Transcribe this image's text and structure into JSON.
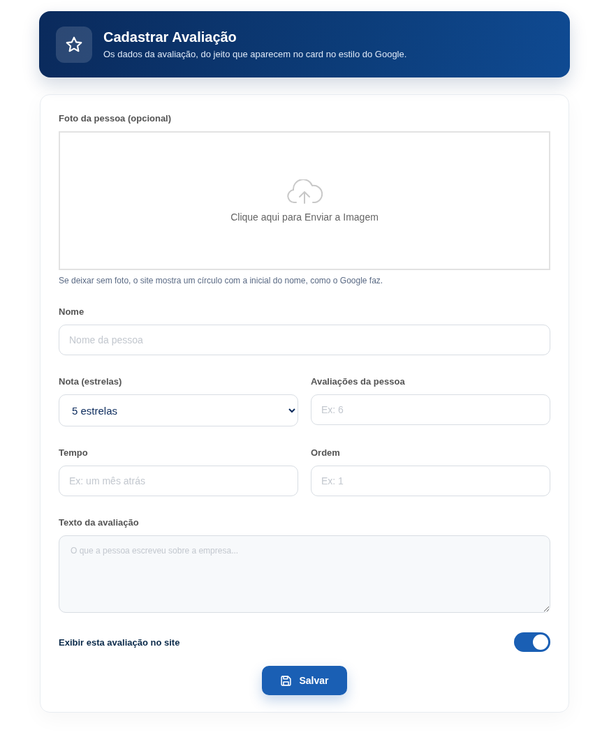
{
  "header": {
    "title": "Cadastrar Avaliação",
    "subtitle": "Os dados da avaliação, do jeito que aparecem no card no estilo do Google."
  },
  "photo": {
    "label": "Foto da pessoa (opcional)",
    "upload_text": "Clique aqui para Enviar a Imagem",
    "hint": "Se deixar sem foto, o site mostra um círculo com a inicial do nome, como o Google faz."
  },
  "rows": [
    [
      {
        "kind": "text",
        "label": "Nome",
        "placeholder": "Nome da pessoa"
      }
    ],
    [
      {
        "kind": "select",
        "label": "Nota (estrelas)",
        "value": "5 estrelas"
      },
      {
        "kind": "text",
        "label": "Avaliações da pessoa",
        "placeholder": "Ex: 6"
      }
    ],
    [
      {
        "kind": "text",
        "label": "Tempo",
        "placeholder": "Ex: um mês atrás"
      },
      {
        "kind": "text",
        "label": "Ordem",
        "placeholder": "Ex: 1"
      }
    ],
    [
      {
        "kind": "textarea",
        "label": "Texto da avaliação",
        "placeholder": "O que a pessoa escreveu sobre a empresa..."
      }
    ]
  ],
  "toggle": {
    "label": "Exibir esta avaliação no site",
    "on": true
  },
  "save_button": {
    "label": "Salvar"
  }
}
